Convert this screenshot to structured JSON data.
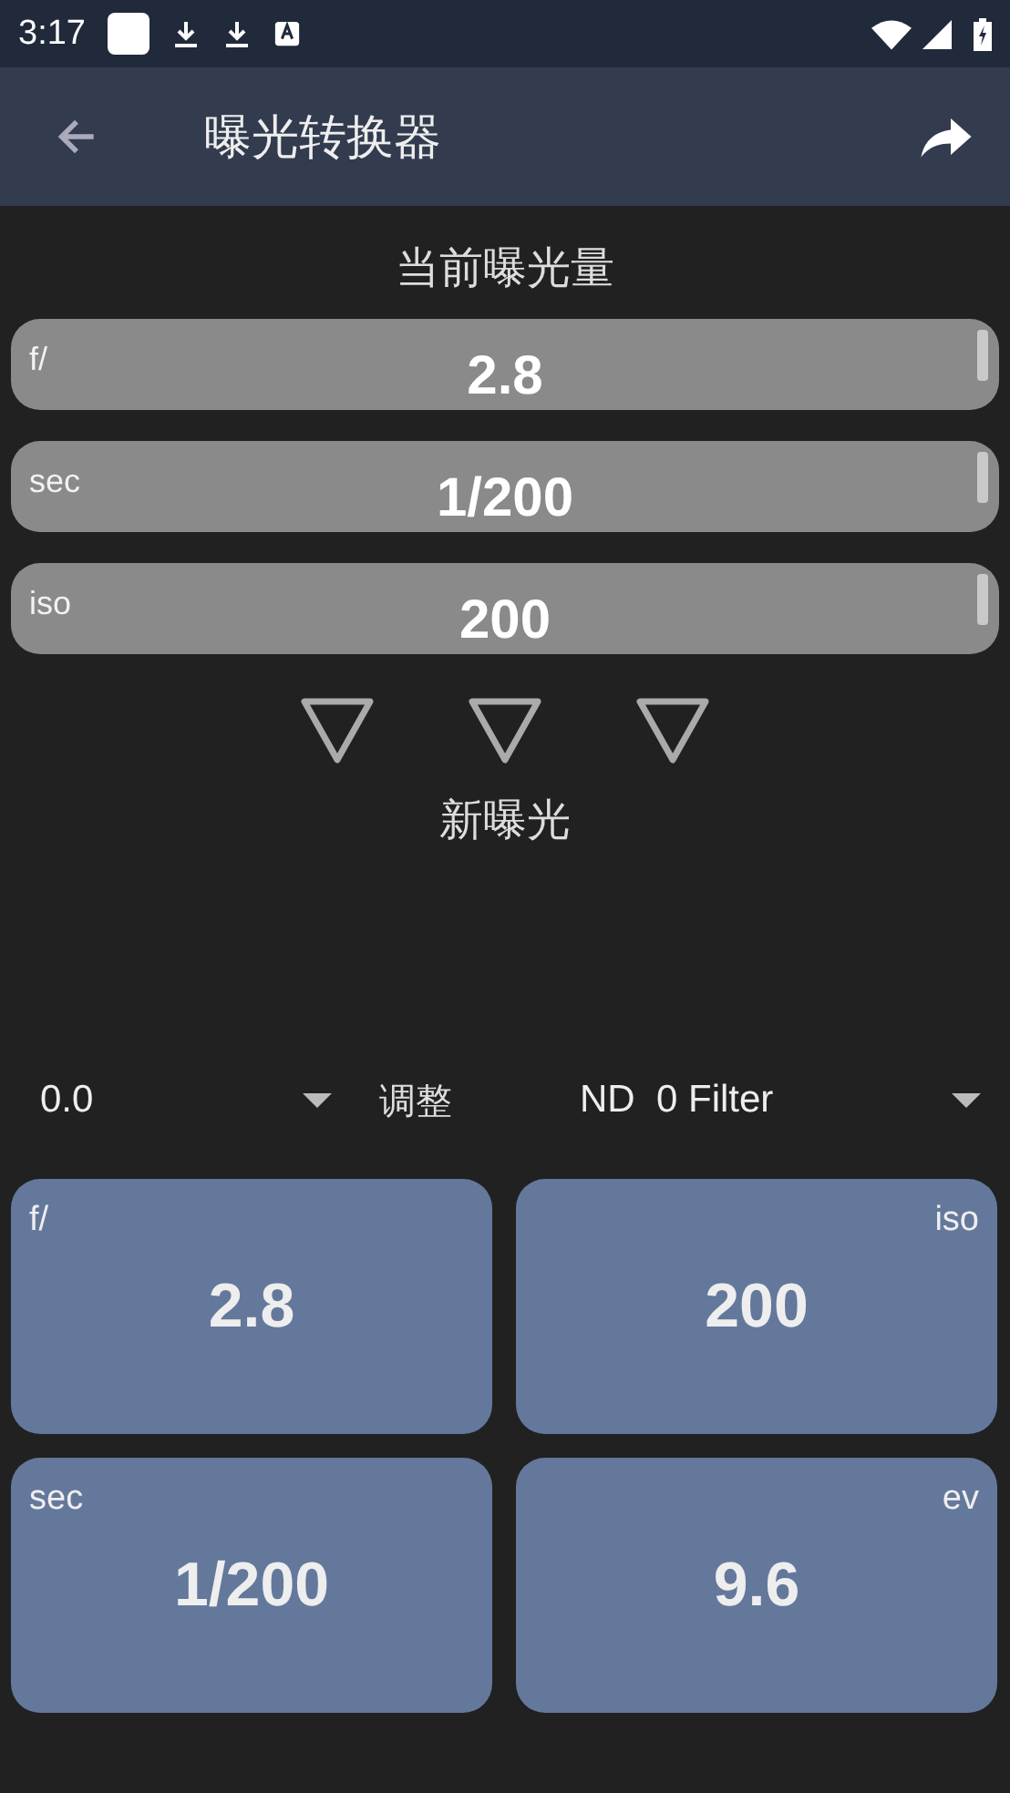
{
  "status_bar": {
    "time": "3:17"
  },
  "toolbar": {
    "title": "曝光转换器"
  },
  "current": {
    "heading": "当前曝光量",
    "pickers": [
      {
        "label": "f/",
        "value": "2.8"
      },
      {
        "label": "sec",
        "value": "1/200"
      },
      {
        "label": "iso",
        "value": "200"
      }
    ]
  },
  "new": {
    "heading": "新曝光",
    "adjust": {
      "value": "0.0",
      "label": "调整"
    },
    "filter": {
      "prefix": "ND",
      "value": "0 Filter"
    },
    "cards": [
      {
        "label": "f/",
        "value": "2.8",
        "kind": "start"
      },
      {
        "label": "iso",
        "value": "200",
        "kind": "end"
      },
      {
        "label": "sec",
        "value": "1/200",
        "kind": "start"
      },
      {
        "label": "ev",
        "value": "9.6",
        "kind": "end"
      }
    ]
  }
}
